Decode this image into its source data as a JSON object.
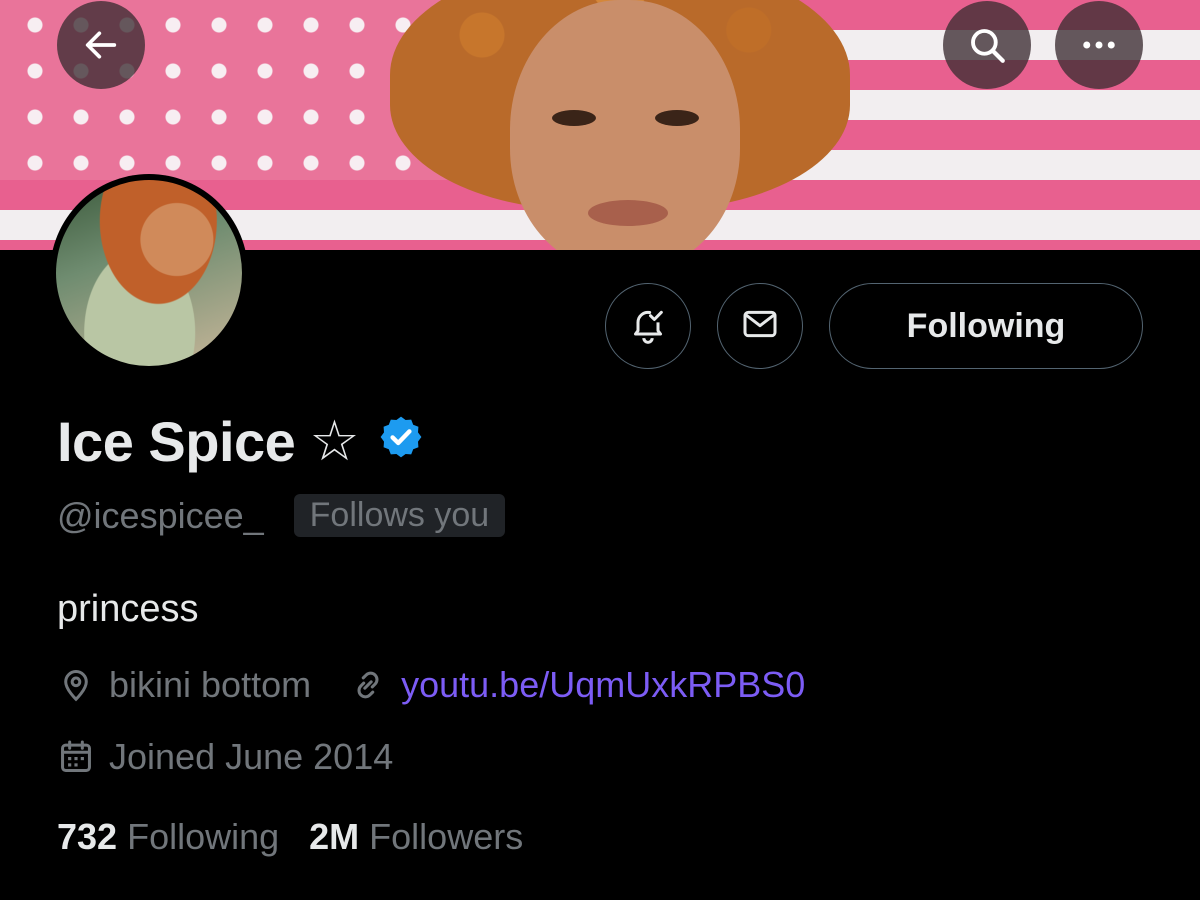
{
  "header": {
    "back_icon": "arrow-left-icon",
    "search_icon": "search-icon",
    "more_icon": "more-horizontal-icon"
  },
  "profile": {
    "name": "Ice Spice",
    "name_star": "☆",
    "verified_icon": "verified-badge-icon",
    "verified_color": "#1d9bf0",
    "handle": "@icespicee_",
    "follows_you": "Follows you",
    "bio": "princess",
    "location": "bikini bottom",
    "website": "youtu.be/UqmUxkRPBS0",
    "website_color": "#7c5cf5",
    "joined": "Joined June 2014"
  },
  "actions": {
    "notify_icon": "bell-check-icon",
    "message_icon": "envelope-icon",
    "following_label": "Following"
  },
  "stats": {
    "following_count": "732",
    "following_label": "Following",
    "followers_count": "2M",
    "followers_label": "Followers"
  }
}
